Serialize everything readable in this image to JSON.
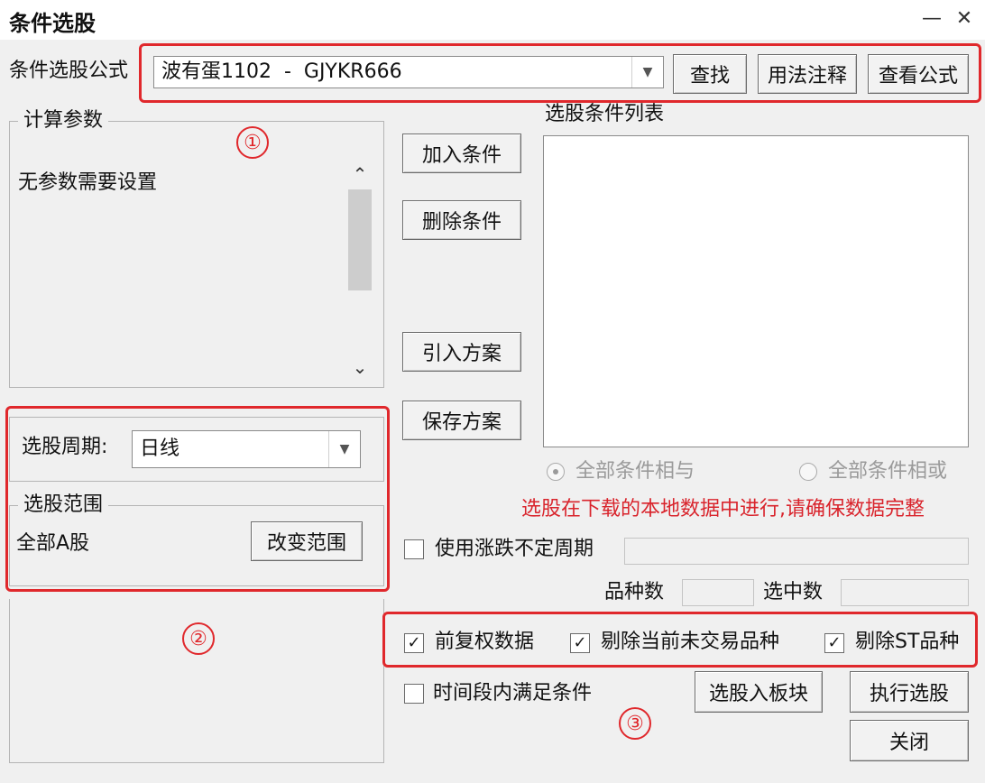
{
  "window": {
    "title": "条件选股",
    "minimize": "—",
    "close": "✕"
  },
  "formula": {
    "label": "条件选股公式",
    "value": "波有蛋1102  -  GJYKR666",
    "find_label": "查找",
    "usage_label": "用法注释",
    "view_label": "查看公式"
  },
  "params": {
    "group_label": "计算参数",
    "text": "无参数需要设置"
  },
  "period": {
    "label": "选股周期:",
    "value": "日线"
  },
  "range": {
    "group_label": "选股范围",
    "value": "全部A股",
    "change_label": "改变范围"
  },
  "actions": {
    "add": "加入条件",
    "delete": "删除条件",
    "import": "引入方案",
    "save": "保存方案"
  },
  "conditions": {
    "list_label": "选股条件列表",
    "items": []
  },
  "logic": {
    "and_label": "全部条件相与",
    "or_label": "全部条件相或",
    "selected": "and"
  },
  "warning": {
    "text": "选股在下载的本地数据中进行,请确保数据完整",
    "color": "#d9242c"
  },
  "options": {
    "use_period_label": "使用涨跌不定周期",
    "use_period_checked": false,
    "variety_label": "品种数",
    "selected_label": "选中数",
    "prev_adjust_label": "前复权数据",
    "prev_adjust_checked": true,
    "exclude_untraded_label": "剔除当前未交易品种",
    "exclude_untraded_checked": true,
    "exclude_st_label": "剔除ST品种",
    "exclude_st_checked": true,
    "time_period_label": "时间段内满足条件",
    "time_period_checked": false
  },
  "bottom": {
    "to_block": "选股入板块",
    "execute": "执行选股",
    "close": "关闭"
  },
  "annotations": {
    "one": "①",
    "two": "②",
    "three": "③",
    "color": "#e0282c"
  }
}
